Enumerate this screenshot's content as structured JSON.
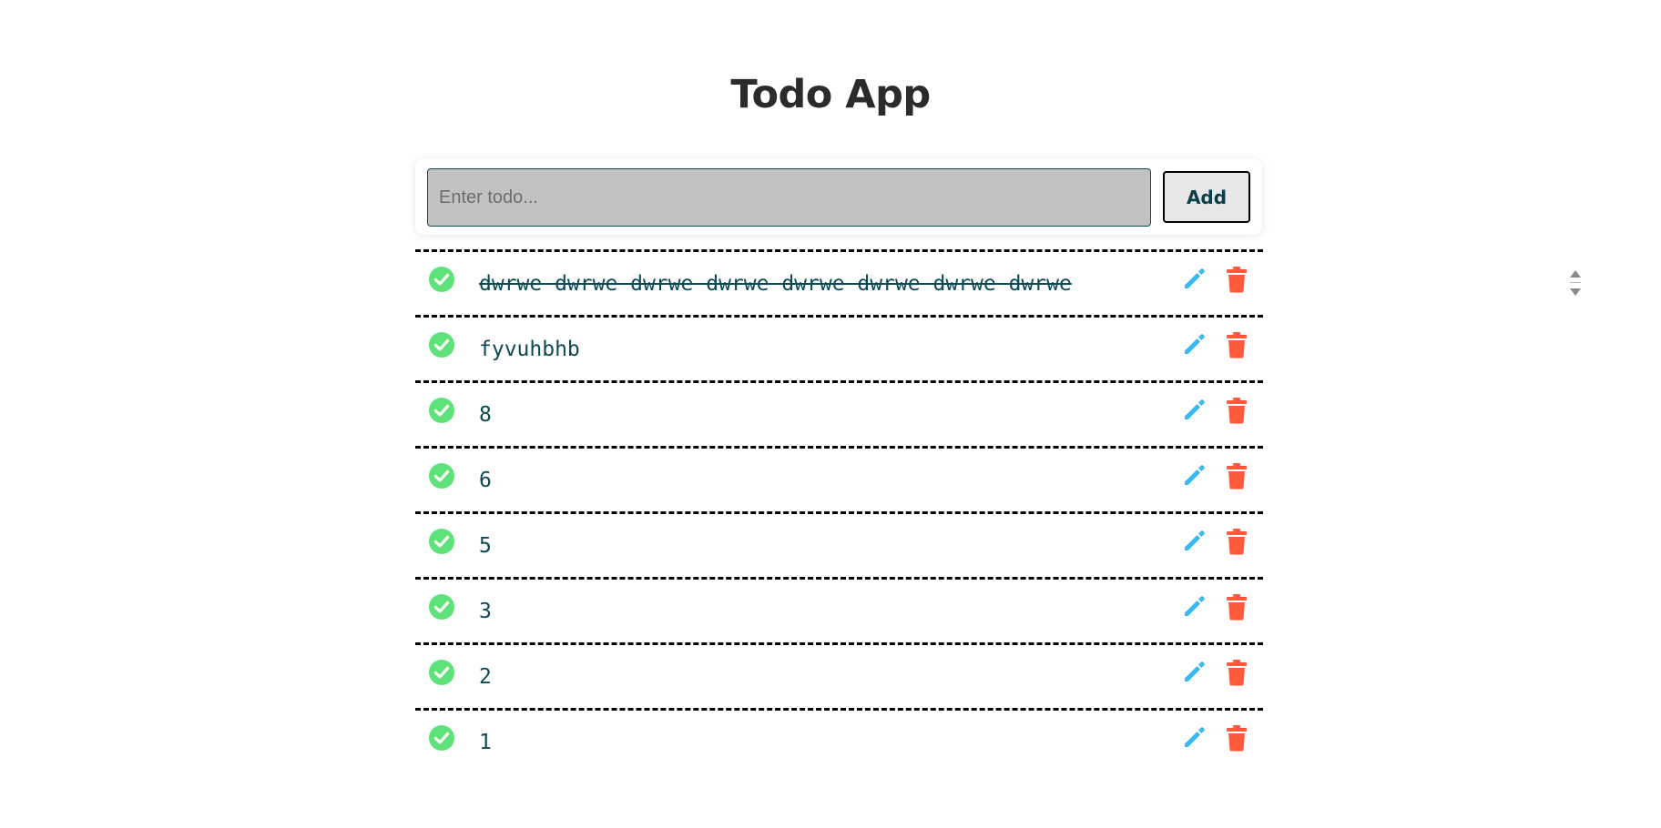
{
  "app": {
    "title": "Todo App"
  },
  "input": {
    "placeholder": "Enter todo...",
    "value": ""
  },
  "add_button": {
    "label": "Add"
  },
  "colors": {
    "check": "#5ee27a",
    "edit": "#39b8ef",
    "delete": "#ff5a3c",
    "text": "#0d4a55"
  },
  "todos": [
    {
      "text": "dwrwe dwrwe dwrwe dwrwe dwrwe dwrwe dwrwe dwrwe",
      "completed": true
    },
    {
      "text": "fyvuhbhb",
      "completed": false
    },
    {
      "text": "8",
      "completed": false
    },
    {
      "text": "6",
      "completed": false
    },
    {
      "text": "5",
      "completed": false
    },
    {
      "text": "3",
      "completed": false
    },
    {
      "text": "2",
      "completed": false
    },
    {
      "text": "1",
      "completed": false
    }
  ],
  "icons": {
    "check": "check-circle-icon",
    "edit": "pencil-icon",
    "delete": "trash-icon",
    "stepper": "stepper-icon"
  }
}
